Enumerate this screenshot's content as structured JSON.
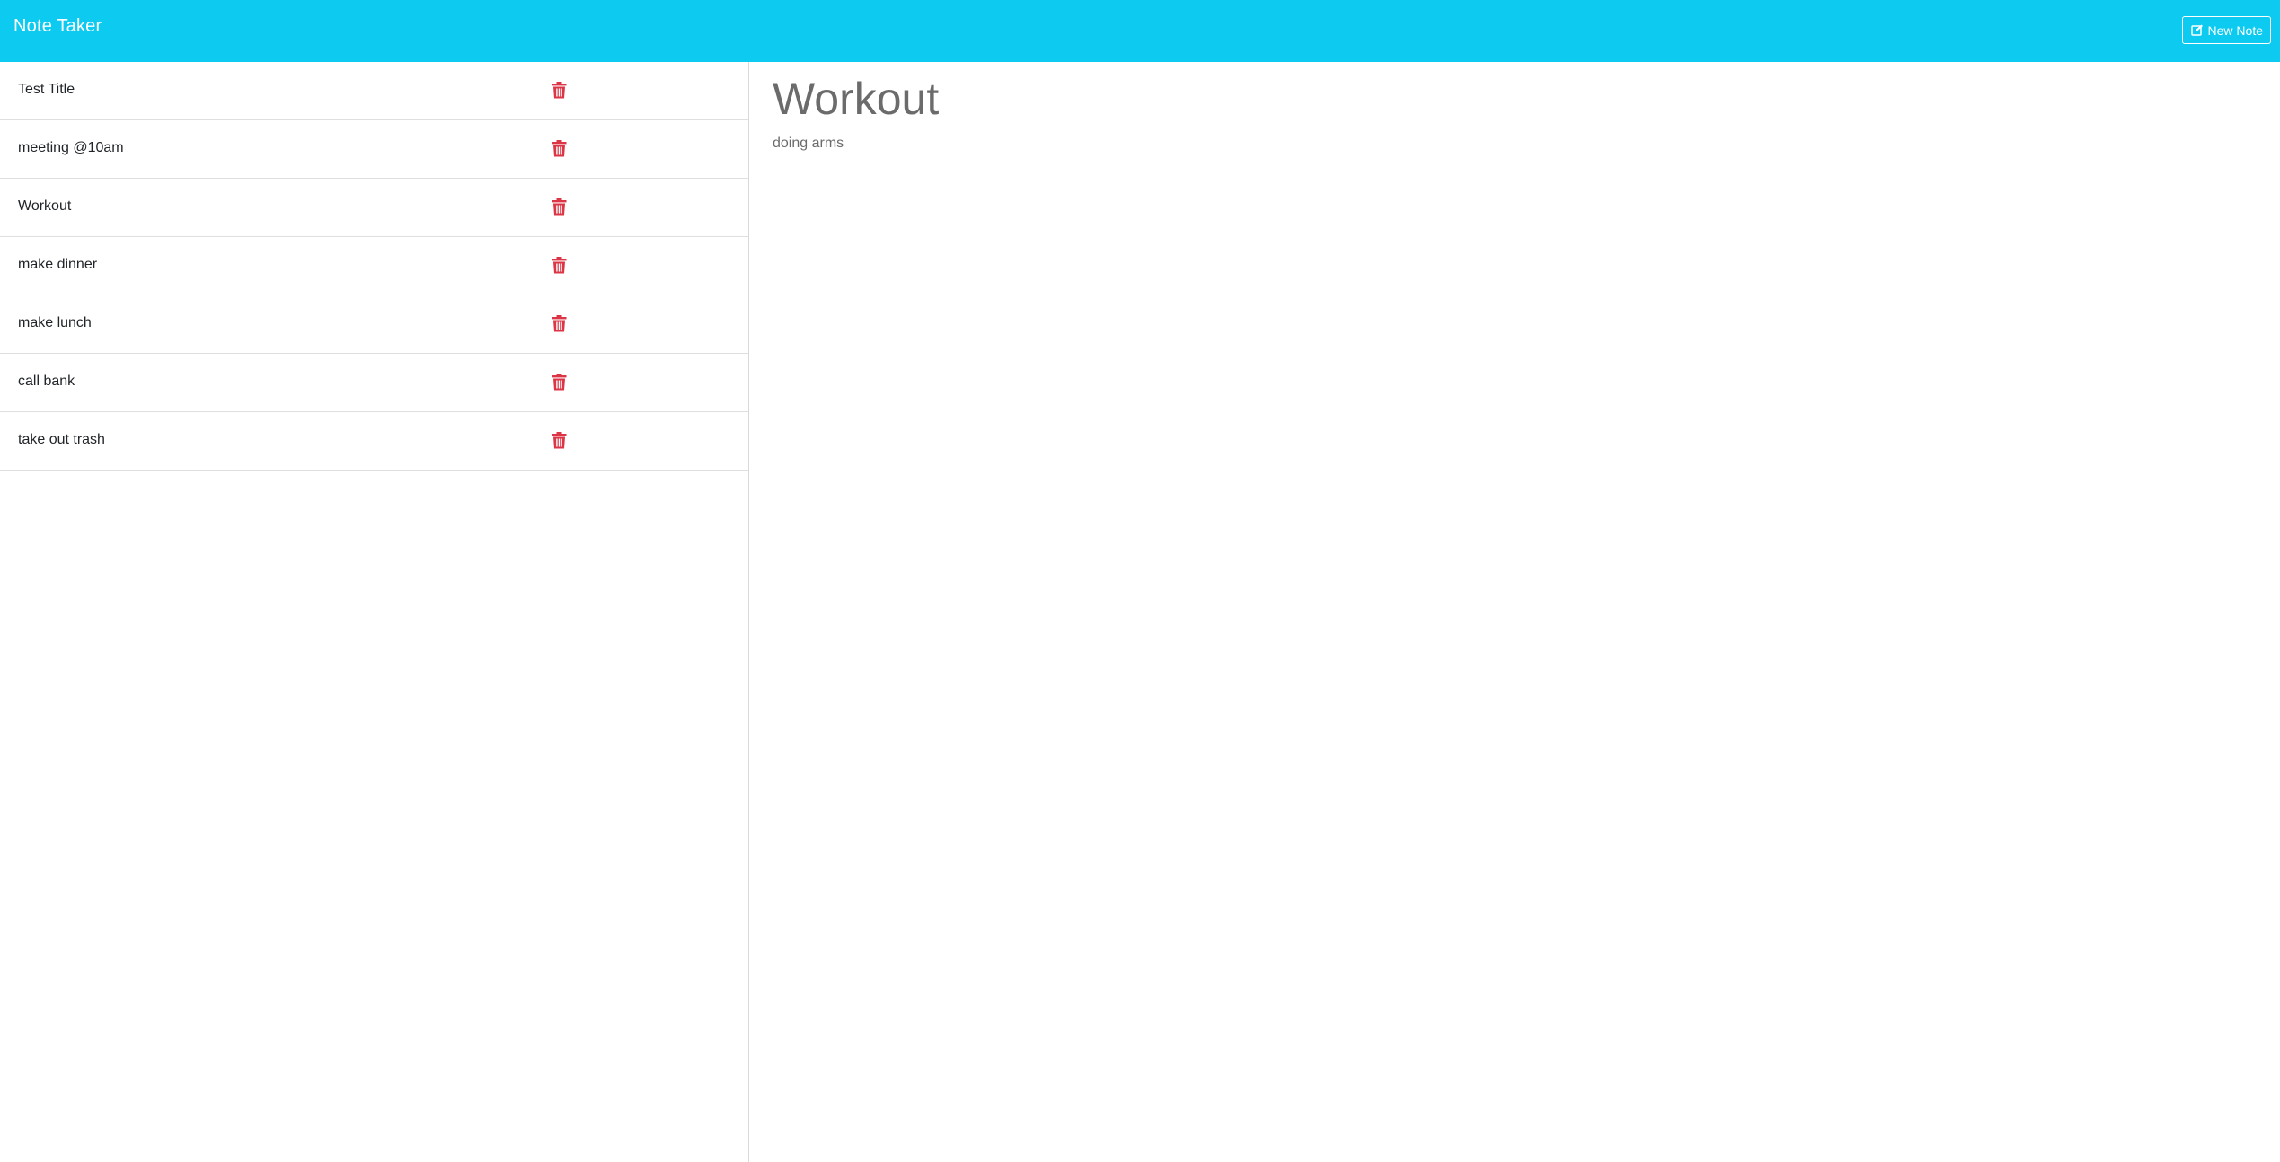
{
  "app": {
    "brand": "Note Taker",
    "new_note_label": "New Note"
  },
  "colors": {
    "navbar": "#0dcaf0",
    "delete_icon": "#dc3545",
    "note_text": "#6b6b6b"
  },
  "notes": [
    {
      "title": "Test Title",
      "icon": "trash-icon"
    },
    {
      "title": "meeting @10am",
      "icon": "trash-icon"
    },
    {
      "title": "Workout",
      "icon": "trash-icon"
    },
    {
      "title": "make dinner",
      "icon": "trash-icon"
    },
    {
      "title": "make lunch",
      "icon": "trash-icon"
    },
    {
      "title": "call bank",
      "icon": "trash-icon"
    },
    {
      "title": "take out trash",
      "icon": "trash-icon"
    }
  ],
  "active_note": {
    "title": "Workout",
    "text": "doing arms"
  }
}
